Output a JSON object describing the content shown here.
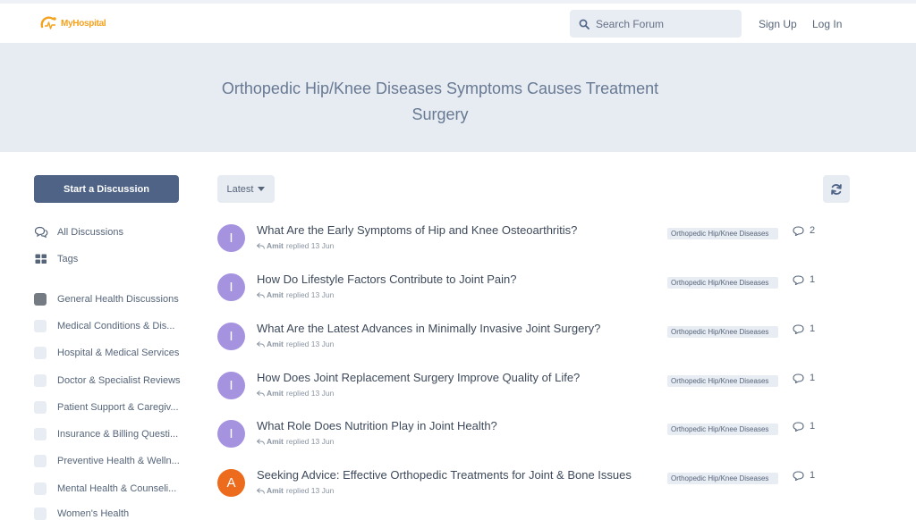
{
  "header": {
    "logo_text": "MyHospital",
    "search_placeholder": "Search Forum",
    "signup_label": "Sign Up",
    "login_label": "Log In"
  },
  "hero": {
    "title": "Orthopedic Hip/Knee Diseases Symptoms Causes Treatment Surgery"
  },
  "sidebar": {
    "start_label": "Start a Discussion",
    "nav": [
      {
        "label": "All Discussions",
        "icon": "discussions-icon"
      },
      {
        "label": "Tags",
        "icon": "tags-icon"
      }
    ],
    "tags": [
      {
        "label": "General Health Discussions",
        "color": "#757b82"
      },
      {
        "label": "Medical Conditions & Dis...",
        "color": "#e8ecf3"
      },
      {
        "label": "Hospital & Medical Services",
        "color": "#e8ecf3"
      },
      {
        "label": "Doctor & Specialist Reviews",
        "color": "#e8ecf3"
      },
      {
        "label": "Patient Support & Caregiv...",
        "color": "#e8ecf3"
      },
      {
        "label": "Insurance & Billing Questi...",
        "color": "#e8ecf3"
      },
      {
        "label": "Preventive Health & Welln...",
        "color": "#e8ecf3"
      },
      {
        "label": "Mental Health & Counseli...",
        "color": "#e8ecf3"
      },
      {
        "label": "Women's Health",
        "color": "#e8ecf3"
      }
    ]
  },
  "toolbar": {
    "sort_label": "Latest"
  },
  "discussions": [
    {
      "initial": "I",
      "title": "What Are the Early Symptoms of Hip and Knee Osteoarthritis?",
      "user": "Amit",
      "action": "replied",
      "date": "13 Jun",
      "tag": "Orthopedic Hip/Knee Diseases",
      "count": "2",
      "avatar_color": "#a593e0"
    },
    {
      "initial": "I",
      "title": "How Do Lifestyle Factors Contribute to Joint Pain?",
      "user": "Amit",
      "action": "replied",
      "date": "13 Jun",
      "tag": "Orthopedic Hip/Knee Diseases",
      "count": "1",
      "avatar_color": "#a593e0"
    },
    {
      "initial": "I",
      "title": "What Are the Latest Advances in Minimally Invasive Joint Surgery?",
      "user": "Amit",
      "action": "replied",
      "date": "13 Jun",
      "tag": "Orthopedic Hip/Knee Diseases",
      "count": "1",
      "avatar_color": "#a593e0"
    },
    {
      "initial": "I",
      "title": "How Does Joint Replacement Surgery Improve Quality of Life?",
      "user": "Amit",
      "action": "replied",
      "date": "13 Jun",
      "tag": "Orthopedic Hip/Knee Diseases",
      "count": "1",
      "avatar_color": "#a593e0"
    },
    {
      "initial": "I",
      "title": "What Role Does Nutrition Play in Joint Health?",
      "user": "Amit",
      "action": "replied",
      "date": "13 Jun",
      "tag": "Orthopedic Hip/Knee Diseases",
      "count": "1",
      "avatar_color": "#a593e0"
    },
    {
      "initial": "A",
      "title": "Seeking Advice: Effective Orthopedic Treatments for Joint & Bone Issues",
      "user": "Amit",
      "action": "replied",
      "date": "13 Jun",
      "tag": "Orthopedic Hip/Knee Diseases",
      "count": "1",
      "avatar_color": "#ec6b1c"
    }
  ]
}
